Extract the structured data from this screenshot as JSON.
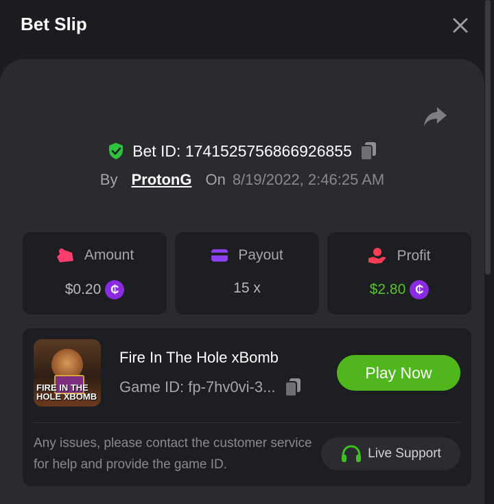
{
  "header": {
    "title": "Bet Slip"
  },
  "bet": {
    "id_label": "Bet ID: 1741525756866926855",
    "by_label": "By",
    "user": "ProtonG",
    "on_label": "On",
    "date": "8/19/2022, 2:46:25 AM"
  },
  "stats": {
    "amount": {
      "label": "Amount",
      "value": "$0.20",
      "coin": "₵"
    },
    "payout": {
      "label": "Payout",
      "value": "15 x"
    },
    "profit": {
      "label": "Profit",
      "value": "$2.80",
      "coin": "₵"
    }
  },
  "game": {
    "name": "Fire In The Hole xBomb",
    "id_label": "Game ID: fp-7hv0vi-3...",
    "play_label": "Play Now",
    "thumb_text_line1": "FIRE IN THE",
    "thumb_text_line2": "HOLE XBOMB"
  },
  "support": {
    "text": "Any issues, please contact the customer service for help and provide the game ID.",
    "button_label": "Live Support"
  },
  "colors": {
    "accent_green": "#4fb61b",
    "profit_green": "#55c42a",
    "coin_purple": "#8a2be2",
    "shield_green": "#2ec23f"
  },
  "icons": [
    "close-icon",
    "share-icon",
    "shield-check-icon",
    "copy-icon",
    "amount-icon",
    "payout-card-icon",
    "profit-hand-icon",
    "headset-icon"
  ]
}
